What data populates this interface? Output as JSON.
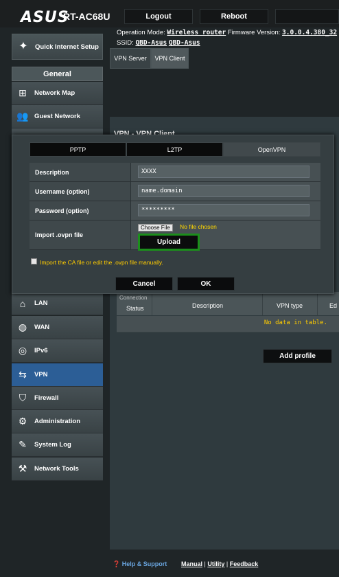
{
  "header": {
    "brand": "ASUS",
    "model": "RT-AC68U",
    "logout_label": "Logout",
    "reboot_label": "Reboot",
    "operation_mode_label": "Operation Mode:",
    "operation_mode_value": "Wireless router",
    "firmware_label": "Firmware Version:",
    "firmware_value": "3.0.0.4.380_32",
    "ssid_label": "SSID:",
    "ssid_1": "QBD-Asus",
    "ssid_2": "QBD-Asus"
  },
  "sidebar": {
    "quick_setup_label": "Quick Internet Setup",
    "general_label": "General",
    "items": [
      {
        "label": "Network Map",
        "icon": "network-map-icon"
      },
      {
        "label": "Guest Network",
        "icon": "guest-network-icon"
      },
      {
        "label": "LAN",
        "icon": "lan-icon"
      },
      {
        "label": "WAN",
        "icon": "wan-icon"
      },
      {
        "label": "IPv6",
        "icon": "ipv6-icon"
      },
      {
        "label": "VPN",
        "icon": "vpn-icon"
      },
      {
        "label": "Firewall",
        "icon": "firewall-icon"
      },
      {
        "label": "Administration",
        "icon": "administration-icon"
      },
      {
        "label": "System Log",
        "icon": "system-log-icon"
      },
      {
        "label": "Network Tools",
        "icon": "network-tools-icon"
      }
    ]
  },
  "tabs": {
    "vpn_server": "VPN Server",
    "vpn_client": "VPN Client"
  },
  "main": {
    "panel_title": "VPN - VPN Client",
    "table": {
      "col_status_top": "Connection",
      "col_status": "Status",
      "col_description": "Description",
      "col_vpn_type": "VPN type",
      "col_edit": "Ed",
      "empty_text": "No data in table."
    },
    "add_profile_label": "Add profile"
  },
  "modal": {
    "tabs": [
      "PPTP",
      "L2TP",
      "OpenVPN"
    ],
    "active_tab": "OpenVPN",
    "fields": {
      "description_label": "Description",
      "description_value": "XXXX",
      "username_label": "Username (option)",
      "username_value": "name.domain",
      "password_label": "Password (option)",
      "password_value": "*********",
      "import_label": "Import .ovpn file",
      "choose_file_label": "Choose File",
      "no_file_text": "No file chosen",
      "upload_label": "Upload"
    },
    "checkbox_label": "Import the CA file or edit the .ovpn file manually.",
    "cancel_label": "Cancel",
    "ok_label": "OK"
  },
  "footer": {
    "help_label": "Help & Support",
    "manual": "Manual",
    "utility": "Utility",
    "feedback": "Feedback"
  },
  "colors": {
    "accent_active": "#2c5e96",
    "highlight_border": "#1b8f1b",
    "warning_text": "#ffcc00"
  }
}
